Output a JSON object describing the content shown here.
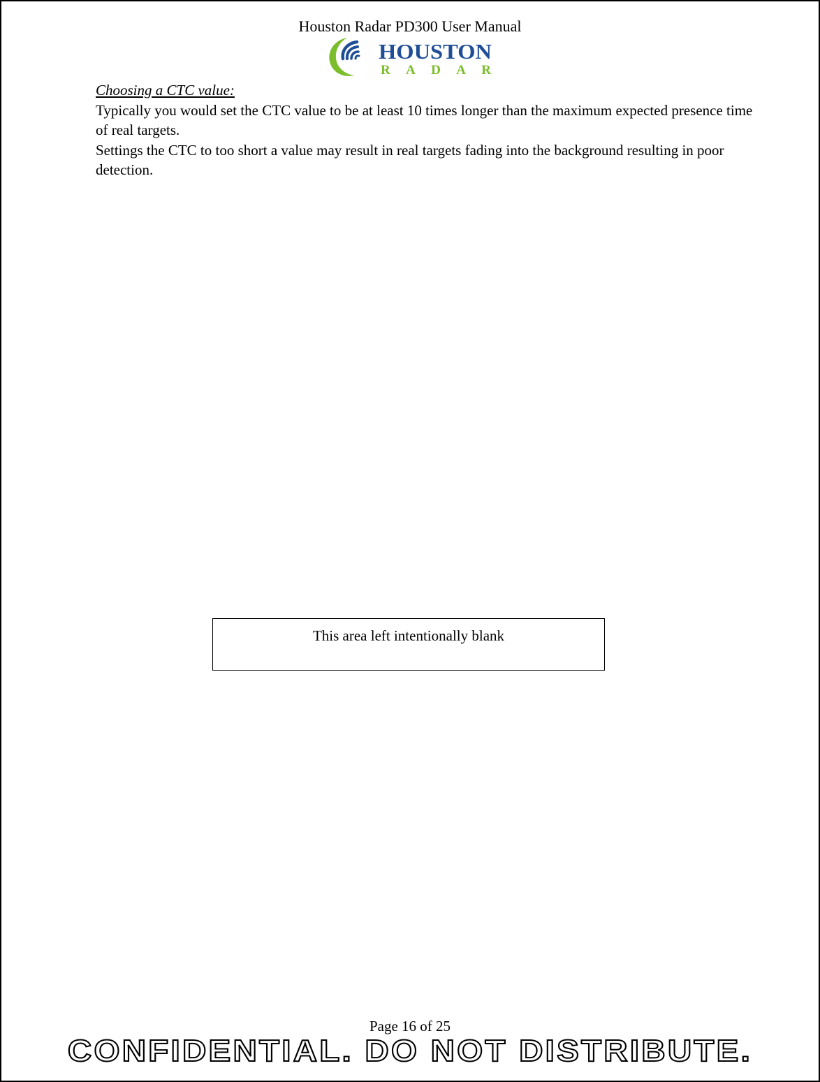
{
  "header": {
    "title": "Houston Radar PD300 User Manual",
    "logo": {
      "icon": "houston-radar-logo-icon",
      "word_top": "HOUSTON",
      "word_bottom": "RADAR",
      "colors": {
        "blue": "#1f4e96",
        "green": "#7bbd2a"
      }
    }
  },
  "content": {
    "heading": "Choosing a CTC value:",
    "paragraphs": [
      "Typically you would set the CTC value to be at least 10 times longer than the maximum expected presence time of real targets.",
      "Settings the CTC to too short a value may result in real targets fading into the background resulting in poor detection."
    ]
  },
  "blank_notice": "This area left intentionally blank",
  "footer": {
    "page_number": "Page 16 of 25",
    "confidential": "CONFIDENTIAL. DO NOT DISTRIBUTE."
  }
}
